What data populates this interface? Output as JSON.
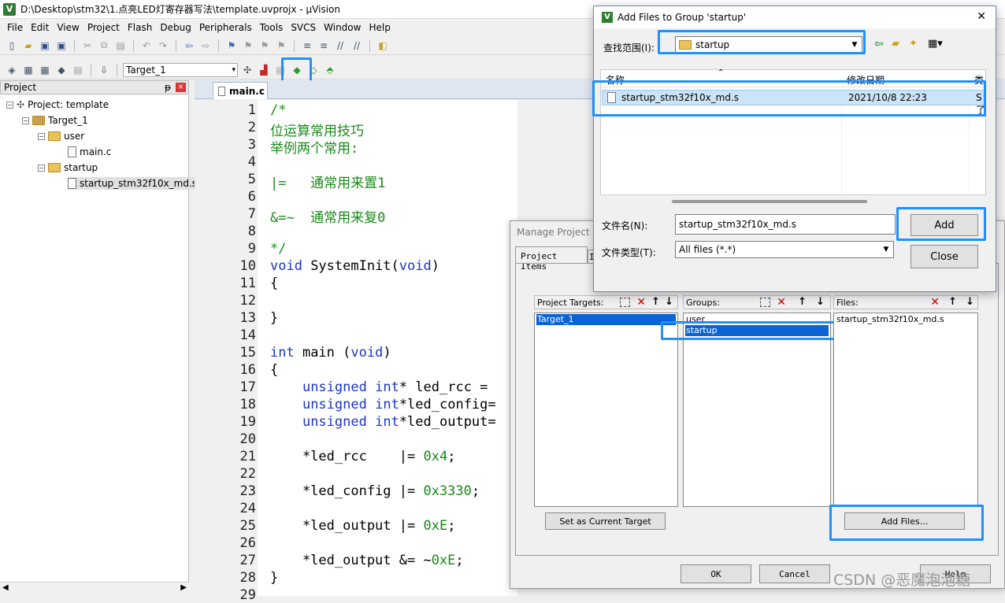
{
  "window": {
    "title": "D:\\Desktop\\stm32\\1.点亮LED灯寄存器写法\\template.uvprojx - µVision"
  },
  "menu": [
    "File",
    "Edit",
    "View",
    "Project",
    "Flash",
    "Debug",
    "Peripherals",
    "Tools",
    "SVCS",
    "Window",
    "Help"
  ],
  "toolbar": {
    "target_select": "Target_1"
  },
  "project_pane": {
    "header": "Project",
    "pin": "ᵽ",
    "close": "×",
    "tree": {
      "root": "Project: template",
      "target": "Target_1",
      "group_user": "user",
      "file_main": "main.c",
      "group_startup": "startup",
      "file_startup": "startup_stm32f10x_md.s"
    }
  },
  "editor": {
    "tab": "main.c",
    "lines": [
      {
        "n": "1",
        "t": "/*"
      },
      {
        "n": "2",
        "t": "位运算常用技巧"
      },
      {
        "n": "3",
        "t": "举例两个常用:"
      },
      {
        "n": "4",
        "t": ""
      },
      {
        "n": "5",
        "t": "|=   通常用来置1"
      },
      {
        "n": "6",
        "t": ""
      },
      {
        "n": "7",
        "t": "&=~  通常用来复0"
      },
      {
        "n": "8",
        "t": ""
      },
      {
        "n": "9",
        "t": "*/"
      },
      {
        "n": "10",
        "t": "void SystemInit(void)"
      },
      {
        "n": "11",
        "t": "{"
      },
      {
        "n": "12",
        "t": ""
      },
      {
        "n": "13",
        "t": "}"
      },
      {
        "n": "14",
        "t": ""
      },
      {
        "n": "15",
        "t": "int main (void)"
      },
      {
        "n": "16",
        "t": "{"
      },
      {
        "n": "17",
        "t": "    unsigned int* led_rcc ="
      },
      {
        "n": "18",
        "t": "    unsigned int*led_config="
      },
      {
        "n": "19",
        "t": "    unsigned int*led_output="
      },
      {
        "n": "20",
        "t": ""
      },
      {
        "n": "21",
        "t": "    *led_rcc    |= 0x4;"
      },
      {
        "n": "22",
        "t": ""
      },
      {
        "n": "23",
        "t": "    *led_config |= 0x3330;"
      },
      {
        "n": "24",
        "t": ""
      },
      {
        "n": "25",
        "t": "    *led_output |= 0xE;"
      },
      {
        "n": "26",
        "t": ""
      },
      {
        "n": "27",
        "t": "    *led_output &= ~0xE;"
      },
      {
        "n": "28",
        "t": "}"
      },
      {
        "n": "29",
        "t": ""
      }
    ]
  },
  "manage": {
    "title": "Manage Project Ite",
    "tab_items": "Project Items",
    "tab_cut": "I",
    "targets_label": "Project Targets:",
    "groups_label": "Groups:",
    "files_label": "Files:",
    "targets": [
      "Target_1"
    ],
    "groups": [
      "user",
      "startup"
    ],
    "files": [
      "startup_stm32f10x_md.s"
    ],
    "set_current": "Set as Current Target",
    "add_files": "Add Files...",
    "ok": "OK",
    "cancel": "Cancel",
    "help": "Help"
  },
  "addfiles": {
    "title": "Add Files to Group 'startup'",
    "lookin_label": "查找范围(I):",
    "lookin_value": "startup",
    "col_name": "名称",
    "col_date": "修改日期",
    "col_type": "类",
    "file_name": "startup_stm32f10x_md.s",
    "file_date": "2021/10/8 22:23",
    "file_type": "S 了",
    "filename_label": "文件名(N):",
    "filename_value": "startup_stm32f10x_md.s",
    "filetype_label": "文件类型(T):",
    "filetype_value": "All files (*.*)",
    "add": "Add",
    "close": "Close"
  },
  "watermark": "CSDN @恶魔泡泡糖",
  "colors": {
    "highlight": "#1e90ff",
    "selection": "#0a64d6",
    "comment": "#1a8a1a",
    "keyword": "#1b35c4"
  }
}
